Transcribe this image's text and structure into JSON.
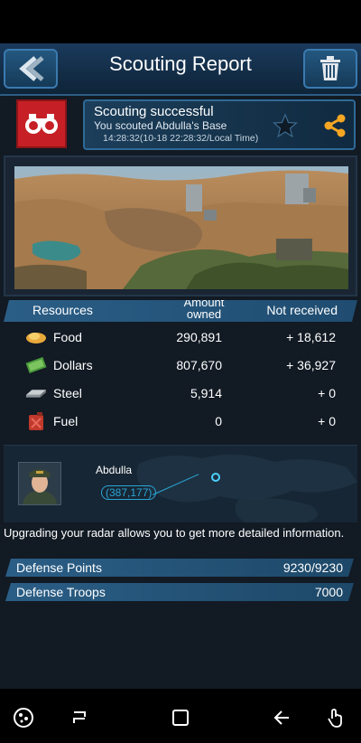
{
  "header": {
    "title": "Scouting Report"
  },
  "scout": {
    "title": "Scouting successful",
    "subtitle": "You scouted Abdulla's Base",
    "time": "14:28:32(10-18 22:28:32/Local Time)"
  },
  "resources": {
    "headers": {
      "resource": "Resources",
      "amount": "Amount owned",
      "not_received": "Not received"
    },
    "rows": [
      {
        "name": "Food",
        "amount": "290,891",
        "not_received": "+ 18,612",
        "icon": "food-icon"
      },
      {
        "name": "Dollars",
        "amount": "807,670",
        "not_received": "+ 36,927",
        "icon": "dollars-icon"
      },
      {
        "name": "Steel",
        "amount": "5,914",
        "not_received": "+ 0",
        "icon": "steel-icon"
      },
      {
        "name": "Fuel",
        "amount": "0",
        "not_received": "+ 0",
        "icon": "fuel-icon"
      }
    ]
  },
  "target": {
    "name": "Abdulla",
    "coords": "(387,177)"
  },
  "upgrade_note": "Upgrading your radar allows you to get more detailed information.",
  "defense": {
    "points_label": "Defense Points",
    "points_value": "9230/9230",
    "troops_label": "Defense Troops",
    "troops_value": "7000"
  },
  "colors": {
    "accent": "#2b5e86",
    "red": "#c62026",
    "coord": "#2aa6d6",
    "share": "#f5a623"
  }
}
